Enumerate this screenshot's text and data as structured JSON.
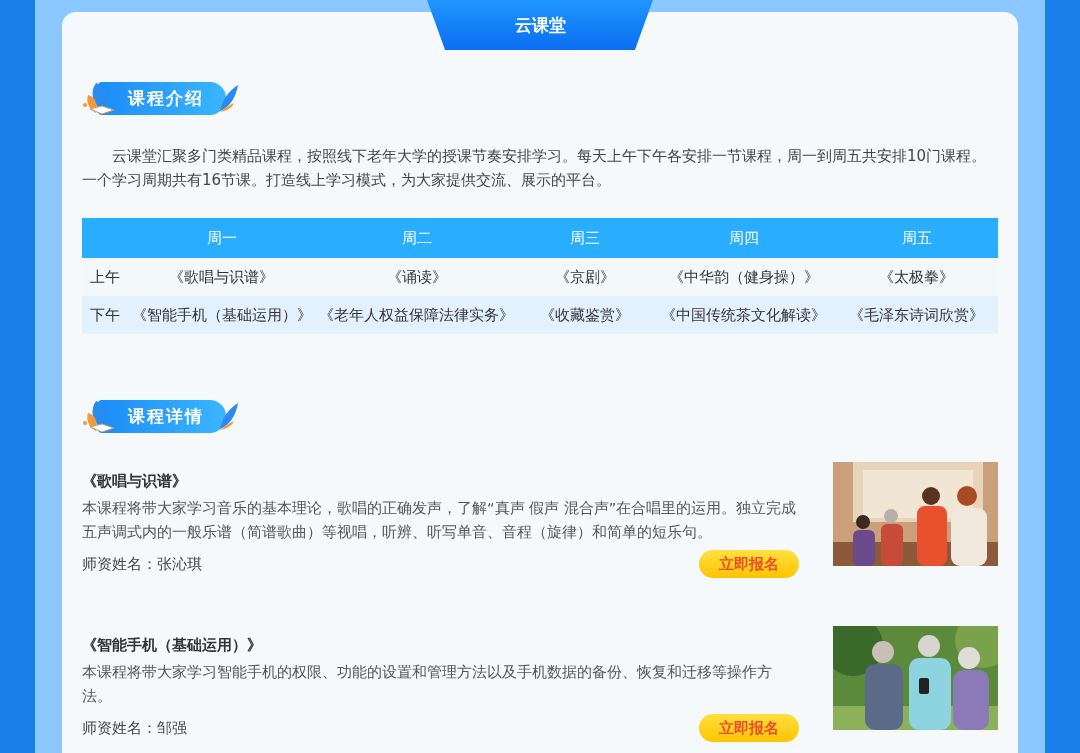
{
  "title": "云课堂",
  "intro": {
    "heading": "课程介绍",
    "text": "云课堂汇聚多门类精品课程，按照线下老年大学的授课节奏安排学习。每天上午下午各安排一节课程，周一到周五共安排10门课程。一个学习周期共有16节课。打造线上学习模式，为大家提供交流、展示的平台。"
  },
  "schedule": {
    "columns": [
      "周一",
      "周二",
      "周三",
      "周四",
      "周五"
    ],
    "rows": [
      {
        "label": "上午",
        "cells": [
          "《歌唱与识谱》",
          "《诵读》",
          "《京剧》",
          "《中华韵（健身操）》",
          "《太极拳》"
        ]
      },
      {
        "label": "下午",
        "cells": [
          "《智能手机（基础运用）》",
          "《老年人权益保障法律实务》",
          "《收藏鉴赏》",
          "《中国传统茶文化解读》",
          "《毛泽东诗词欣赏》"
        ]
      }
    ]
  },
  "details": {
    "heading": "课程详情",
    "courses": [
      {
        "title": "《歌唱与识谱》",
        "description": "本课程将带大家学习音乐的基本理论，歌唱的正确发声，了解“真声 假声 混合声”在合唱里的运用。独立完成五声调式内的一般乐谱（简谱歌曲）等视唱，听辨、听写单音、音程（旋律）和简单的短乐句。",
        "teacher": "师资姓名：张沁琪",
        "button": "立即报名"
      },
      {
        "title": "《智能手机（基础运用）》",
        "description": "本课程将带大家学习智能手机的权限、功能的设置和管理方法以及手机数据的备份、恢复和迁移等操作方法。",
        "teacher": "师资姓名：邹强",
        "button": "立即报名"
      }
    ]
  }
}
